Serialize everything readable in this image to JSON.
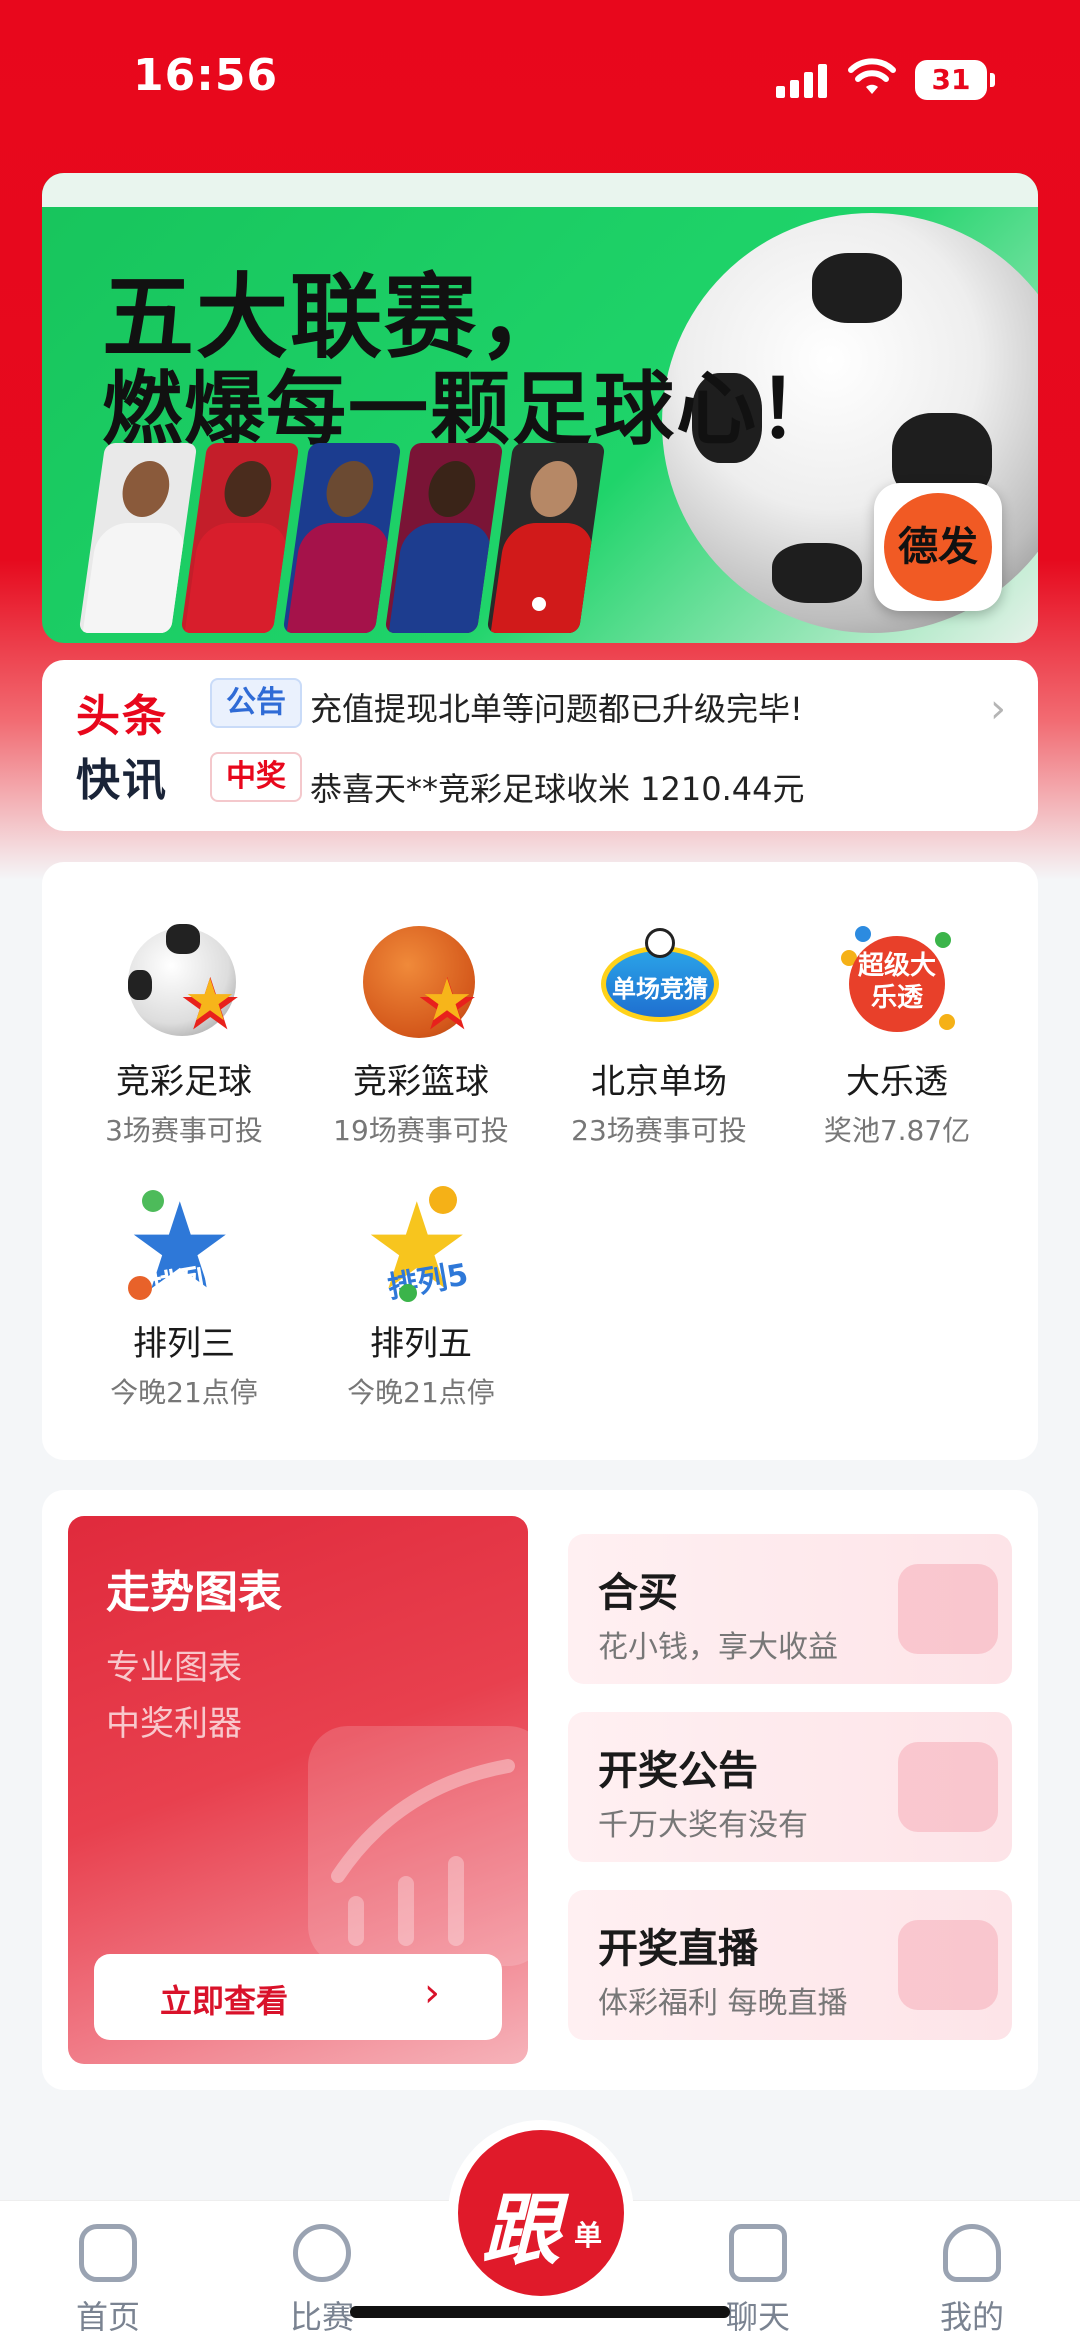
{
  "status_bar": {
    "time": "16:56",
    "battery": "31"
  },
  "banner": {
    "title_line1": "五大联赛，",
    "title_line2": "燃爆每一颗足球心！",
    "logo_text": "德发",
    "colors": {
      "bg": "#1fd46a"
    }
  },
  "news": {
    "headline_1": "头条",
    "headline_2": "快讯",
    "tag_notice": "公告",
    "notice_text": "充值提现北单等问题都已升级完毕!",
    "tag_win": "中奖",
    "win_text": "恭喜天**竞彩足球收米 1210.44元"
  },
  "lottery": [
    {
      "name": "竞彩足球",
      "sub": "3场赛事可投",
      "icon": "soccer-ball-icon"
    },
    {
      "name": "竞彩篮球",
      "sub": "19场赛事可投",
      "icon": "basketball-icon"
    },
    {
      "name": "北京单场",
      "sub": "23场赛事可投",
      "icon": "beijing-single-icon",
      "badge": "单场竞猜"
    },
    {
      "name": "大乐透",
      "sub": "奖池7.87亿",
      "icon": "super-lotto-icon",
      "badge": "超级大乐透"
    },
    {
      "name": "排列三",
      "sub": "今晚21点停",
      "icon": "pailie3-icon",
      "badge": "排列3"
    },
    {
      "name": "排列五",
      "sub": "今晚21点停",
      "icon": "pailie5-icon",
      "badge": "排列5"
    }
  ],
  "features": {
    "trend": {
      "title": "走势图表",
      "line1": "专业图表",
      "line2": "中奖利器",
      "button": "立即查看"
    },
    "cards": [
      {
        "title": "合买",
        "desc": "花小钱，享大收益",
        "icon": "handshake-icon"
      },
      {
        "title": "开奖公告",
        "desc": "千万大奖有没有",
        "icon": "star-notice-icon"
      },
      {
        "title": "开奖直播",
        "desc": "体彩福利 每晚直播",
        "icon": "video-camera-icon"
      }
    ]
  },
  "nav": {
    "home": "首页",
    "match": "比赛",
    "follow_main": "跟",
    "follow_sub": "单",
    "chat": "聊天",
    "mine": "我的"
  },
  "colors": {
    "primary_red": "#e8071c",
    "accent_green": "#1fd46a"
  }
}
